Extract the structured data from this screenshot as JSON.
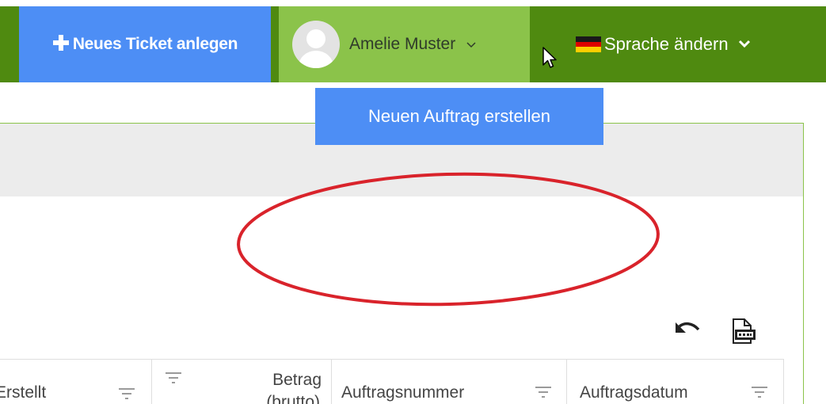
{
  "topbar": {
    "new_ticket_label": "Neues Ticket anlegen",
    "user_name": "Amelie Muster",
    "language_label": "Sprache ändern"
  },
  "main": {
    "create_order_label": "Neuen Auftrag erstellen"
  },
  "table": {
    "columns": [
      {
        "label": "Erstellt"
      },
      {
        "label": "Betrag",
        "sublabel": "(brutto)"
      },
      {
        "label": "Auftragsnummer"
      },
      {
        "label": "Auftragsdatum"
      }
    ]
  },
  "colors": {
    "primary_blue": "#4d8ef5",
    "dark_green": "#4f8a10",
    "light_green": "#8bc34a",
    "highlight_red": "#d9232b"
  },
  "icons": [
    "plus-icon",
    "avatar",
    "chevron-down-icon",
    "mouse-cursor-icon",
    "german-flag-icon",
    "undo-icon",
    "xlsx-export-icon",
    "filter-icon"
  ]
}
